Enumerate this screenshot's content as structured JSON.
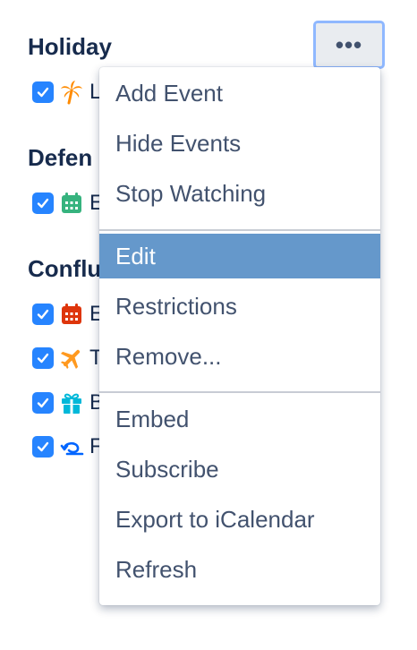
{
  "more_button": {
    "label": "•••"
  },
  "groups": [
    {
      "title": "Holiday",
      "calendars": [
        {
          "name": "L",
          "checked": true,
          "icon": "palm-tree-icon",
          "icon_color": "#ff8b00"
        }
      ]
    },
    {
      "title": "Defen",
      "calendars": [
        {
          "name": "E",
          "checked": true,
          "icon": "calendar-icon",
          "icon_color": "#36b37e"
        }
      ]
    },
    {
      "title": "Conflu",
      "calendars": [
        {
          "name": "E",
          "checked": true,
          "icon": "calendar-icon",
          "icon_color": "#de350b"
        },
        {
          "name": "T",
          "checked": true,
          "icon": "airplane-icon",
          "icon_color": "#ff991f"
        },
        {
          "name": "B",
          "checked": true,
          "icon": "gift-icon",
          "icon_color": "#00b8d9"
        },
        {
          "name": "F",
          "checked": true,
          "icon": "rotate-arrow-icon",
          "icon_color": "#0065ff"
        }
      ]
    }
  ],
  "menu": {
    "sections": [
      [
        "Add Event",
        "Hide Events",
        "Stop Watching"
      ],
      [
        "Edit",
        "Restrictions",
        "Remove..."
      ],
      [
        "Embed",
        "Subscribe",
        "Export to iCalendar",
        "Refresh"
      ]
    ],
    "active_item": "Edit"
  },
  "colors": {
    "checkbox": "#2684ff",
    "menu_active_bg": "#6598cb",
    "text": "#172b4d",
    "menu_text": "#42526e"
  }
}
